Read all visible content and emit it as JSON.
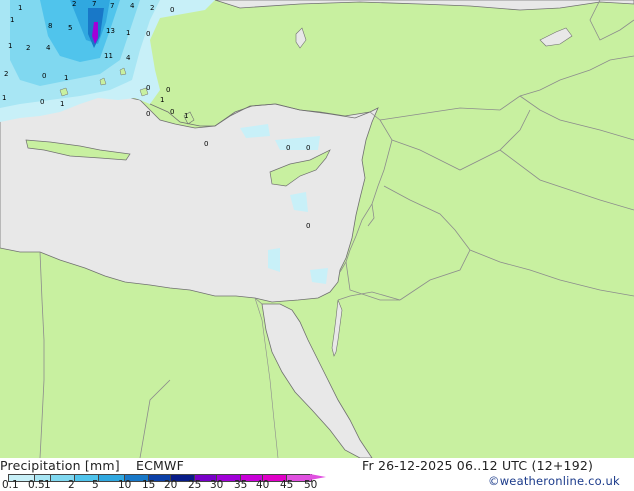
{
  "legend": {
    "title": "Precipitation [mm]",
    "model": "ECMWF",
    "valid_time": "Fr 26-12-2025 06..12 UTC (12+192)",
    "credit": "©weatheronline.co.uk",
    "ticks": [
      "0.1",
      "0.5",
      "1",
      "2",
      "5",
      "10",
      "15",
      "20",
      "25",
      "30",
      "35",
      "40",
      "45",
      "50"
    ],
    "colors": [
      "#ffffff",
      "#c8f0f8",
      "#a8e6f4",
      "#80d8f0",
      "#50c4ec",
      "#30a8e0",
      "#1878c8",
      "#0c40a8",
      "#081c88",
      "#7800c8",
      "#a000d8",
      "#c800d8",
      "#e000c8",
      "#e050e0"
    ]
  },
  "map_values": [
    "1",
    "2",
    "7",
    "7",
    "4",
    "2",
    "0",
    "1",
    "8",
    "5",
    "13",
    "1",
    "0",
    "1",
    "2",
    "4",
    "11",
    "4",
    "2",
    "0",
    "1",
    "1",
    "0",
    "1",
    "0",
    "1",
    "0",
    "0",
    "0",
    "1",
    "0",
    "0",
    "0",
    "0"
  ],
  "colors": {
    "land": "#c8f0a0",
    "sea": "#e8e8e8",
    "border": "#8c8c8c",
    "coast": "#707070"
  }
}
